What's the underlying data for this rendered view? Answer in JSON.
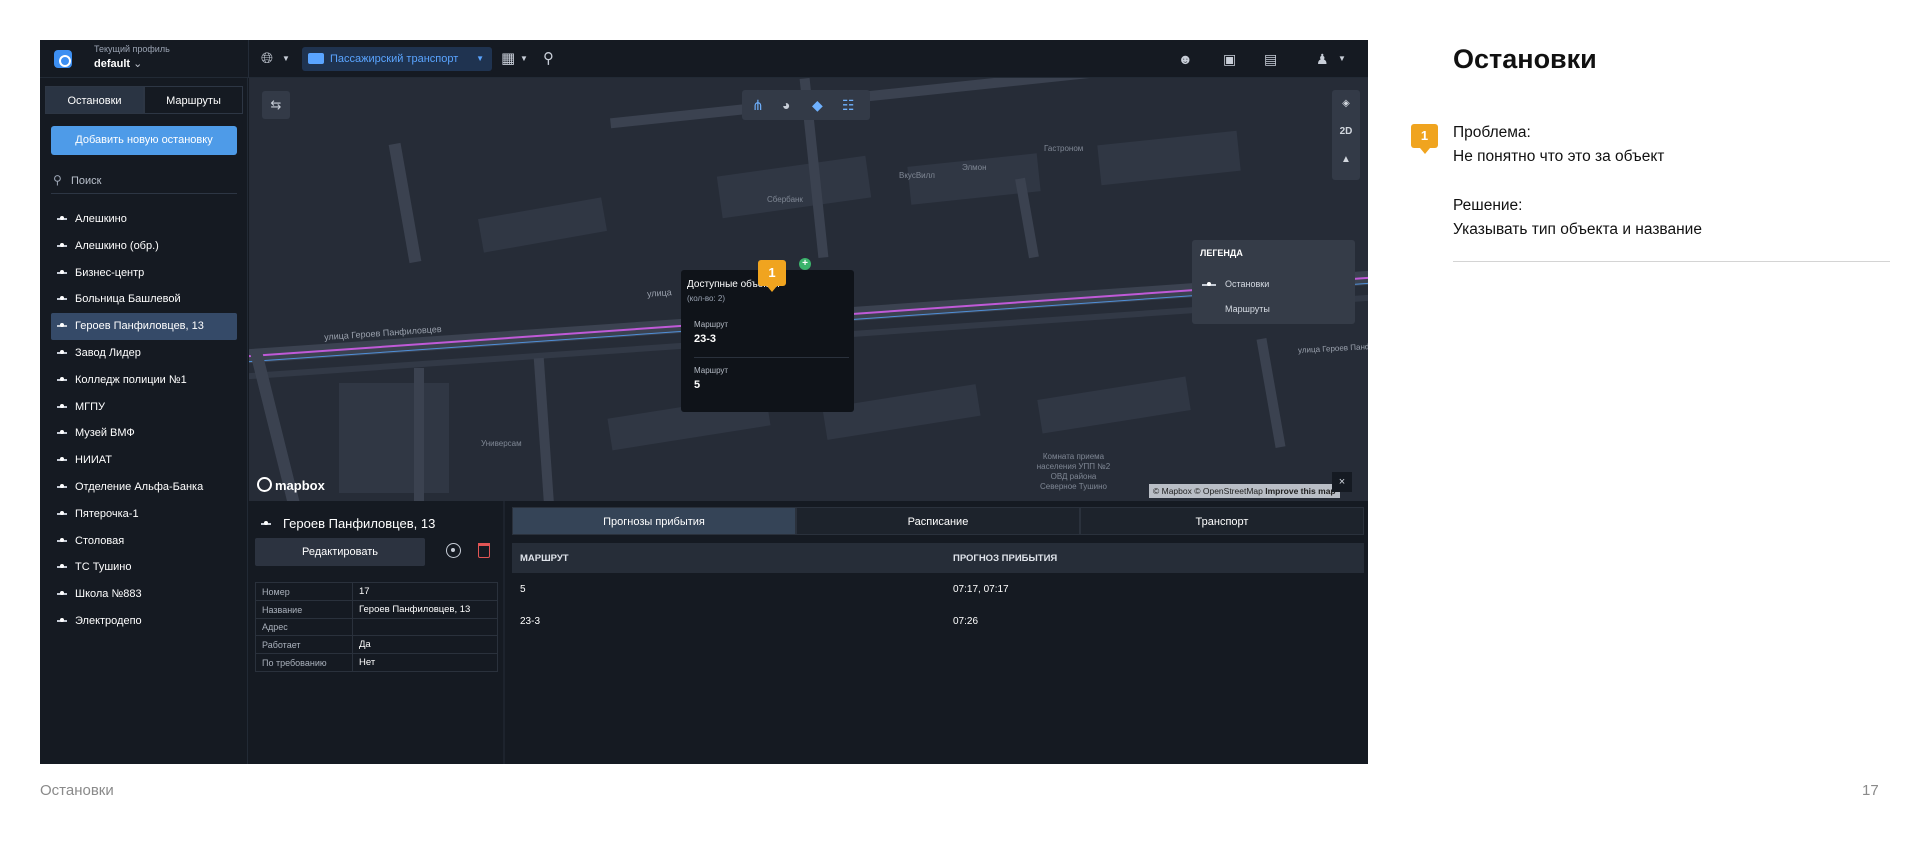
{
  "slide": {
    "title": "Остановки",
    "marker": "1",
    "problem_label": "Проблема:",
    "problem_text": "Не понятно что это за объект",
    "solution_label": "Решение:",
    "solution_text": "Указывать тип объекта и название",
    "footer_title": "Остановки",
    "page_number": "17"
  },
  "header": {
    "profile_caption": "Текущий профиль",
    "profile_value": "default",
    "transport_mode": "Пассажирский транспорт",
    "icons": [
      "globe-icon",
      "bus-icon",
      "layout-grid-icon",
      "car-search-icon",
      "users-icon",
      "archive-icon",
      "clipboard-icon",
      "user-icon"
    ]
  },
  "sidebar": {
    "tabs": [
      {
        "label": "Остановки",
        "active": true
      },
      {
        "label": "Маршруты",
        "active": false
      }
    ],
    "add_button": "Добавить новую остановку",
    "search_placeholder": "Поиск",
    "stops": [
      {
        "name": "Алешкино",
        "active": false
      },
      {
        "name": "Алешкино (обр.)",
        "active": false
      },
      {
        "name": "Бизнес-центр",
        "active": false
      },
      {
        "name": "Больница Башлевой",
        "active": false
      },
      {
        "name": "Героев Панфиловцев, 13",
        "active": true
      },
      {
        "name": "Завод Лидер",
        "active": false
      },
      {
        "name": "Колледж полиции №1",
        "active": false
      },
      {
        "name": "МГПУ",
        "active": false
      },
      {
        "name": "Музей ВМФ",
        "active": false
      },
      {
        "name": "НИИАТ",
        "active": false
      },
      {
        "name": "Отделение Альфа-Банка",
        "active": false
      },
      {
        "name": "Пятерочка-1",
        "active": false
      },
      {
        "name": "Столовая",
        "active": false
      },
      {
        "name": "ТС Тушино",
        "active": false
      },
      {
        "name": "Школа №883",
        "active": false
      },
      {
        "name": "Электродепо",
        "active": false
      }
    ]
  },
  "map": {
    "street_labels": [
      "улица Героев Панфиловцев",
      "улица",
      "улица Героев Панф"
    ],
    "poi_labels": [
      "Сбербанк",
      "ВкусВилл",
      "Элмон",
      "Гастроном",
      "Универсам",
      "Комната приема населения УПП №2 ОВД района Северное Тушино"
    ],
    "view_mode": "2D",
    "legend": {
      "title": "ЛЕГЕНДА",
      "items": [
        "Остановки",
        "Маршруты"
      ],
      "colors": {
        "routes": "#c05ad8",
        "stops": "#ffffff"
      }
    },
    "popup": {
      "title": "Доступные объекты",
      "count": "(кол-во: 2)",
      "items": [
        {
          "caption": "Маршрут",
          "value": "23-3"
        },
        {
          "caption": "Маршрут",
          "value": "5"
        }
      ]
    },
    "attribution": {
      "text": "© Mapbox © OpenStreetMap",
      "link": "Improve this map"
    },
    "close": "×",
    "mapbox_logo": "mapbox",
    "marker": "1",
    "add_dot": "+"
  },
  "details": {
    "stop_name": "Героев Панфиловцев, 13",
    "edit_button": "Редактировать",
    "properties": [
      {
        "key": "Номер",
        "value": "17"
      },
      {
        "key": "Название",
        "value": "Героев Панфиловцев, 13"
      },
      {
        "key": "Адрес",
        "value": ""
      },
      {
        "key": "Работает",
        "value": "Да"
      },
      {
        "key": "По требованию",
        "value": "Нет"
      }
    ],
    "tabs": [
      {
        "label": "Прогнозы прибытия",
        "active": true
      },
      {
        "label": "Расписание",
        "active": false
      },
      {
        "label": "Транспорт",
        "active": false
      }
    ],
    "forecast": {
      "columns": [
        "МАРШРУТ",
        "ПРОГНОЗ ПРИБЫТИЯ"
      ],
      "rows": [
        {
          "route": "5",
          "arrival": "07:17, 07:17"
        },
        {
          "route": "23-3",
          "arrival": "07:26"
        }
      ]
    }
  },
  "colors": {
    "accent": "#4e9be8",
    "marker": "#f0a41f",
    "background": "#151a22"
  }
}
